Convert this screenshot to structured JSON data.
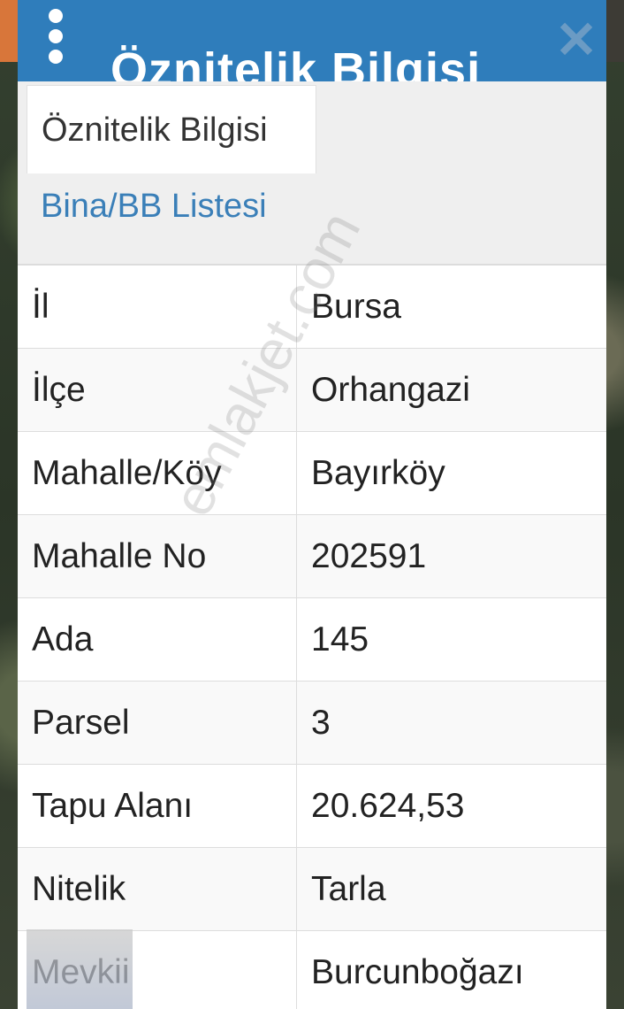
{
  "header": {
    "title": "Öznitelik Bilgisi",
    "menu_icon": "more-vertical-icon",
    "close_icon": "close-icon"
  },
  "tabs": [
    {
      "label": "Öznitelik Bilgisi",
      "active": true
    },
    {
      "label": "Bina/BB Listesi",
      "active": false
    }
  ],
  "attributes": [
    {
      "key": "İl",
      "value": "Bursa"
    },
    {
      "key": "İlçe",
      "value": "Orhangazi"
    },
    {
      "key": "Mahalle/Köy",
      "value": "Bayırköy"
    },
    {
      "key": "Mahalle No",
      "value": "202591"
    },
    {
      "key": "Ada",
      "value": "145"
    },
    {
      "key": "Parsel",
      "value": "3"
    },
    {
      "key": "Tapu Alanı",
      "value": "20.624,53"
    },
    {
      "key": "Nitelik",
      "value": "Tarla"
    },
    {
      "key": "Mevkii",
      "value": "Burcunboğazı"
    }
  ],
  "watermark": "emlakjet.com",
  "colors": {
    "header": "#2f7dbb",
    "link": "#3a7fb8"
  }
}
